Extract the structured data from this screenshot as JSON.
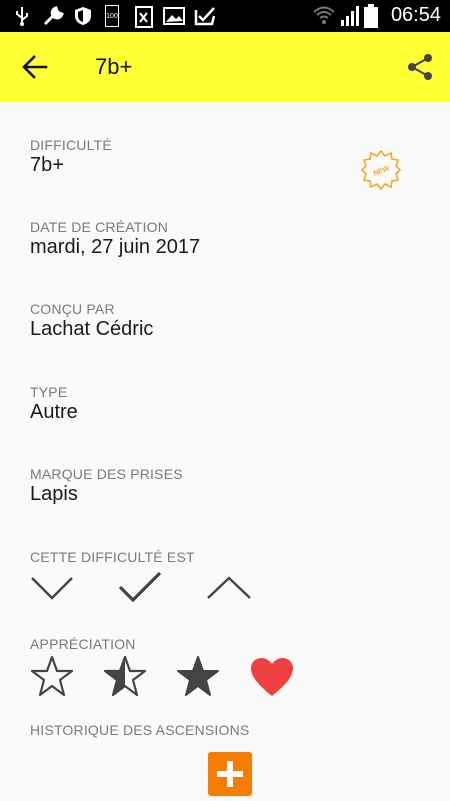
{
  "status_bar": {
    "time": "06:54",
    "battery_label": "100"
  },
  "app_bar": {
    "title": "7b+"
  },
  "fields": {
    "difficulty": {
      "label": "DIFFICULTÉ",
      "value": "7b+"
    },
    "created": {
      "label": "DATE DE CRÉATION",
      "value": "mardi, 27 juin 2017"
    },
    "designer": {
      "label": "CONÇU PAR",
      "value": "Lachat Cédric"
    },
    "type": {
      "label": "TYPE",
      "value": "Autre"
    },
    "holds_brand": {
      "label": "MARQUE DES PRISES",
      "value": "Lapis"
    }
  },
  "new_badge": {
    "text": "NEW",
    "color": "#f5a623"
  },
  "difficulty_feedback": {
    "label": "CETTE DIFFICULTÉ EST",
    "options": [
      "chevron-down-icon",
      "check-icon",
      "chevron-up-icon"
    ]
  },
  "appreciation": {
    "label": "APPRÉCIATION",
    "options": [
      "star-outline-icon",
      "star-half-icon",
      "star-filled-icon",
      "heart-icon"
    ],
    "heart_color": "#f04040"
  },
  "history": {
    "label": "HISTORIQUE DES ASCENSIONS",
    "add_color": "#f57c00"
  }
}
